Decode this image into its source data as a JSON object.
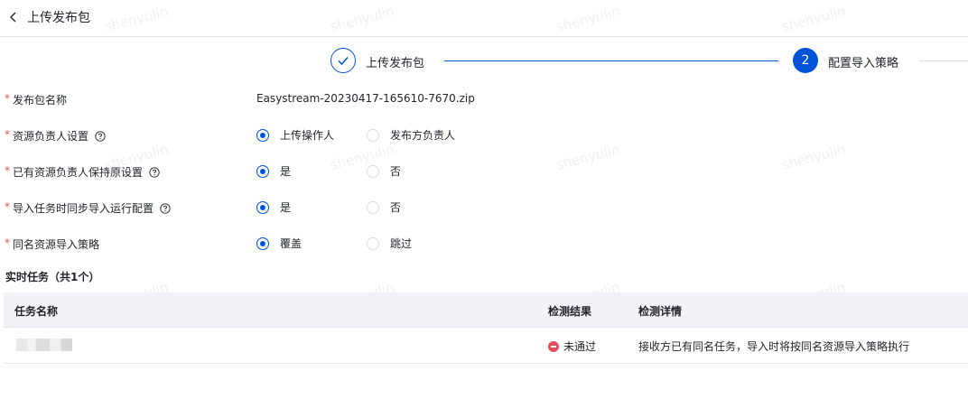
{
  "header": {
    "title": "上传发布包"
  },
  "steps": [
    {
      "label": "上传发布包",
      "state": "done"
    },
    {
      "number": "2",
      "label": "配置导入策略",
      "state": "active"
    }
  ],
  "form": {
    "package_name": {
      "label": "发布包名称",
      "value": "Easystream-20230417-165610-7670.zip"
    },
    "resource_owner": {
      "label": "资源负责人设置",
      "option_a": "上传操作人",
      "option_b": "发布方负责人",
      "selected": "上传操作人"
    },
    "keep_owner": {
      "label": "已有资源负责人保持原设置",
      "option_a": "是",
      "option_b": "否",
      "selected": "是"
    },
    "sync_config": {
      "label": "导入任务时同步导入运行配置",
      "option_a": "是",
      "option_b": "否",
      "selected": "是"
    },
    "same_name": {
      "label": "同名资源导入策略",
      "option_a": "覆盖",
      "option_b": "跳过",
      "selected": "覆盖"
    },
    "required_mark": "*"
  },
  "realtime": {
    "title": "实时任务（共1个）",
    "columns": [
      "任务名称",
      "检测结果",
      "检测详情"
    ],
    "rows": [
      {
        "name": "",
        "result": "未通过",
        "detail": "接收方已有同名任务，导入时将按同名资源导入策略执行"
      }
    ]
  },
  "watermark": "shenyulin",
  "colors": {
    "primary": "#0052d9",
    "error": "#e34d59",
    "header_bg": "#f2f3f8"
  }
}
